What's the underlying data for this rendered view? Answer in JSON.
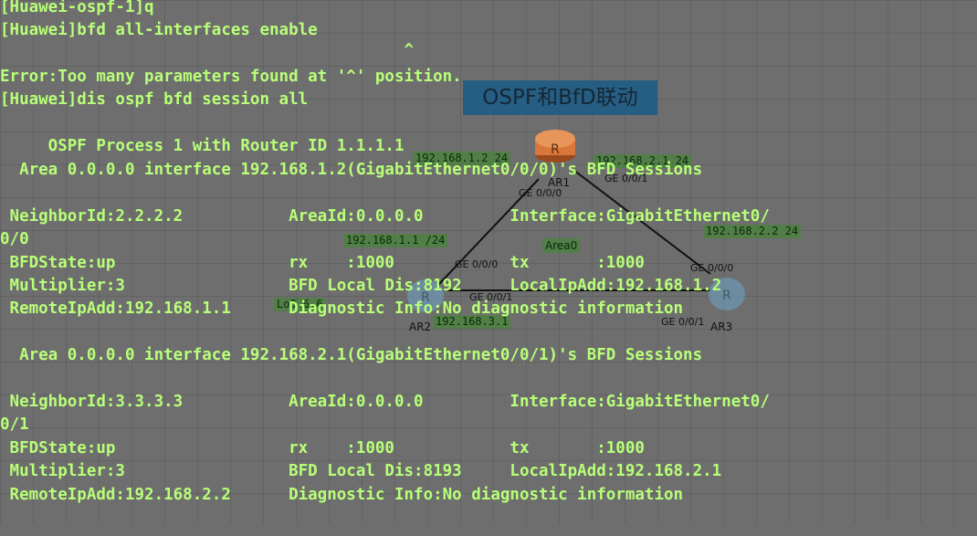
{
  "topology": {
    "title": "OSPF和BfD联动",
    "area_label": "Area0",
    "routers": [
      {
        "name": "AR1",
        "glyph": "R"
      },
      {
        "name": "AR2",
        "glyph": "R"
      },
      {
        "name": "AR3",
        "glyph": "R"
      }
    ],
    "ip_tags": [
      "192.168.1.2 24",
      "192.168.2.1 24",
      "192.168.1.1 /24",
      "192.168.2.2 24",
      "192.168.3.1",
      "Lo0 6.6"
    ],
    "ports": [
      "GE 0/0/0",
      "GE 0/0/1",
      "GE 0/0/0",
      "GE 0/0/1",
      "GE 0/0/0",
      "GE 0/0/1"
    ]
  },
  "terminal": {
    "lines": [
      "[Huawei-ospf-1]q",
      "[Huawei]bfd all-interfaces enable",
      "                                          ^",
      "Error:Too many parameters found at '^' position.",
      "[Huawei]dis ospf bfd session all",
      "",
      "     OSPF Process 1 with Router ID 1.1.1.1",
      "  Area 0.0.0.0 interface 192.168.1.2(GigabitEthernet0/0/0)'s BFD Sessions",
      "",
      " NeighborId:2.2.2.2           AreaId:0.0.0.0         Interface:GigabitEthernet0/",
      "0/0",
      " BFDState:up                  rx    :1000            tx       :1000",
      " Multiplier:3                 BFD Local Dis:8192     LocalIpAdd:192.168.1.2",
      " RemoteIpAdd:192.168.1.1      Diagnostic Info:No diagnostic information",
      "",
      "  Area 0.0.0.0 interface 192.168.2.1(GigabitEthernet0/0/1)'s BFD Sessions",
      "",
      " NeighborId:3.3.3.3           AreaId:0.0.0.0         Interface:GigabitEthernet0/",
      "0/1",
      " BFDState:up                  rx    :1000            tx       :1000",
      " Multiplier:3                 BFD Local Dis:8193     LocalIpAdd:192.168.2.1",
      " RemoteIpAdd:192.168.2.2      Diagnostic Info:No diagnostic information"
    ]
  },
  "colors": {
    "terminal_text": "#b8ff78",
    "background": "#6e6e6e",
    "title_box": "#1f5d86",
    "router_body": "#d9773a",
    "router_other": "#6fa6c8"
  }
}
